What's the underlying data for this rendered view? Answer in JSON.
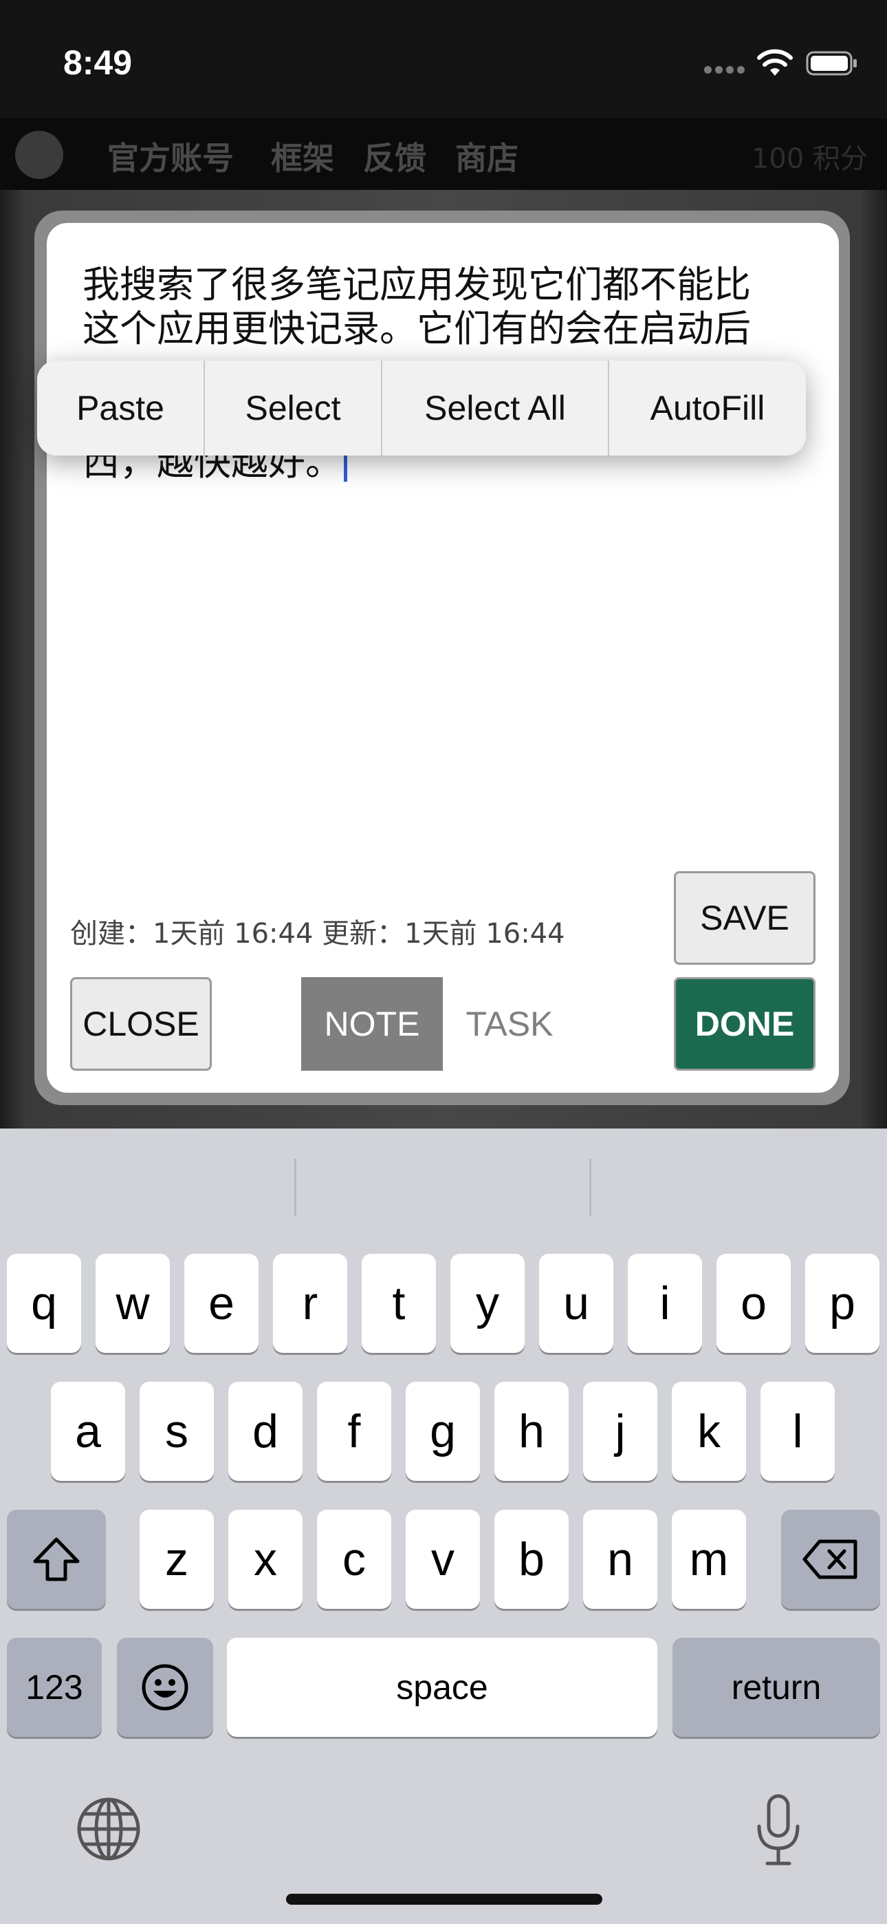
{
  "status_bar": {
    "time": "8:49"
  },
  "nav": {
    "items": [
      "官方账号",
      "框架",
      "反馈",
      "商店"
    ],
    "points": "100 积分"
  },
  "note": {
    "text": "我搜索了很多笔记应用发现它们都不能比\n这个应用更快记录。它们有的会在启动后\n\n的。有的时候我只是想快速记录一些东\n西，越快越好。",
    "timestamps": "创建：1天前 16:44 更新：1天前 16:44"
  },
  "context_menu": {
    "items": [
      "Paste",
      "Select",
      "Select All",
      "AutoFill"
    ]
  },
  "buttons": {
    "save": "SAVE",
    "close": "CLOSE",
    "note_tab": "NOTE",
    "task_tab": "TASK",
    "done": "DONE"
  },
  "keyboard": {
    "row1": [
      "q",
      "w",
      "e",
      "r",
      "t",
      "y",
      "u",
      "i",
      "o",
      "p"
    ],
    "row2": [
      "a",
      "s",
      "d",
      "f",
      "g",
      "h",
      "j",
      "k",
      "l"
    ],
    "row3": [
      "z",
      "x",
      "c",
      "v",
      "b",
      "n",
      "m"
    ],
    "numbers_key": "123",
    "space_key": "space",
    "return_key": "return",
    "icons": [
      "shift-icon",
      "delete-icon",
      "emoji-icon",
      "globe-icon",
      "microphone-icon"
    ]
  },
  "colors": {
    "done_button": "#1b6a4f",
    "note_tab_active": "#7f7f7f",
    "cursor": "#2f5fdc",
    "keyboard_bg": "#d1d3d9"
  }
}
